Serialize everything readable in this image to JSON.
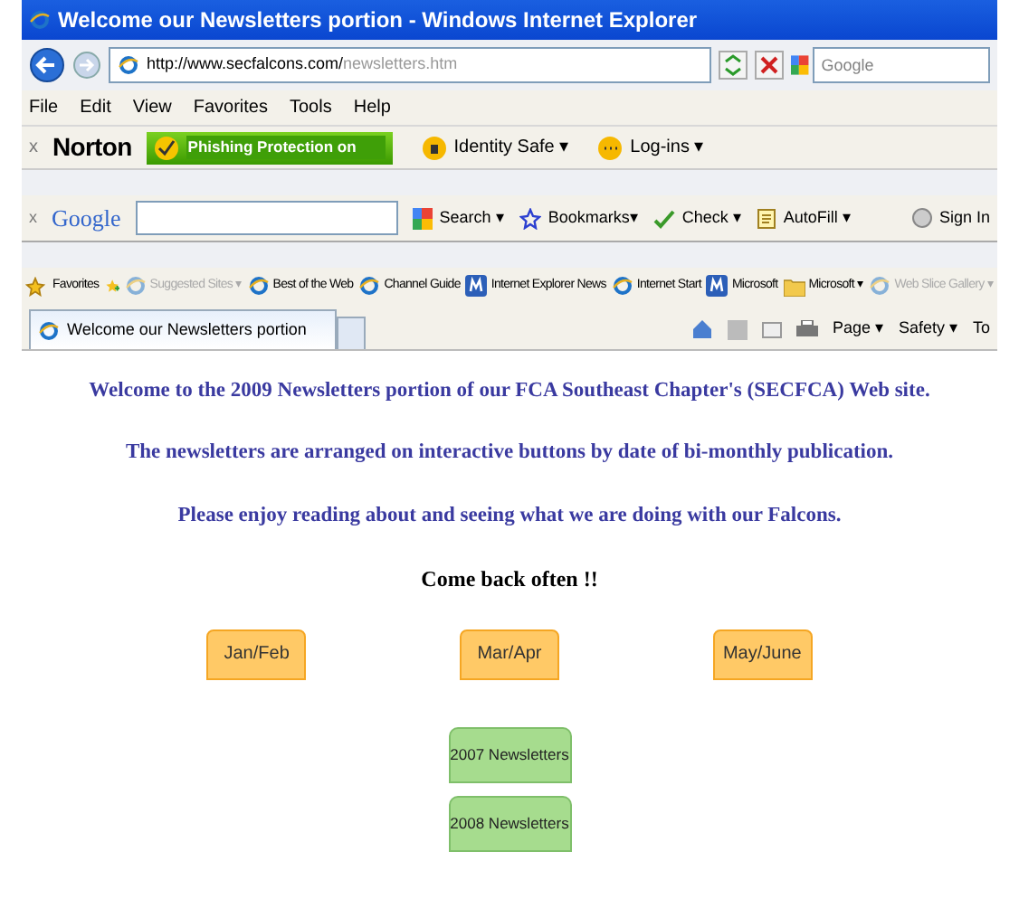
{
  "window": {
    "title": "Welcome our Newsletters portion - Windows Internet Explorer"
  },
  "address_bar": {
    "url_host": "http://www.secfalcons.com/",
    "url_path": "newsletters.htm",
    "search_placeholder": "Google"
  },
  "menu": [
    "File",
    "Edit",
    "View",
    "Favorites",
    "Tools",
    "Help"
  ],
  "norton_toolbar": {
    "close": "x",
    "brand": "Norton",
    "phishing": "Phishing Protection on",
    "items": [
      "Identity Safe ▾",
      "Log-ins ▾"
    ]
  },
  "google_toolbar": {
    "close": "x",
    "brand": "Google",
    "items": [
      {
        "kind": "search",
        "label": "Search ▾"
      },
      {
        "kind": "bookmarks",
        "label": "Bookmarks▾"
      },
      {
        "kind": "check",
        "label": "Check ▾"
      },
      {
        "kind": "autofill",
        "label": "AutoFill ▾"
      },
      {
        "kind": "signin",
        "label": "Sign In"
      }
    ]
  },
  "favorites_bar": {
    "label": "Favorites",
    "items": [
      {
        "label": "Suggested Sites ▾",
        "kind": "ie",
        "disabled": true
      },
      {
        "label": "Best of the Web",
        "kind": "ie",
        "disabled": false
      },
      {
        "label": "Channel Guide",
        "kind": "ie",
        "disabled": false
      },
      {
        "label": "Internet Explorer News",
        "kind": "ms",
        "disabled": false
      },
      {
        "label": "Internet Start",
        "kind": "ie",
        "disabled": false
      },
      {
        "label": "Microsoft",
        "kind": "ms",
        "disabled": false
      },
      {
        "label": "Microsoft ▾",
        "kind": "folder",
        "disabled": false
      },
      {
        "label": "Web Slice Gallery ▾",
        "kind": "ie",
        "disabled": true
      }
    ]
  },
  "tab": {
    "title": "Welcome our Newsletters portion"
  },
  "command_bar": [
    "Page ▾",
    "Safety ▾",
    "To"
  ],
  "page": {
    "paragraphs": [
      {
        "text": "Welcome to the 2009 Newsletters portion of our FCA Southeast Chapter's (SECFCA) Web site.",
        "kind": "intro"
      },
      {
        "text": "The newsletters are arranged on interactive buttons by date of bi-monthly publication.",
        "kind": "intro"
      },
      {
        "text": "Please enjoy reading about and seeing what we are doing with our Falcons.",
        "kind": "intro"
      },
      {
        "text": "Come back often !!",
        "kind": "closing"
      }
    ],
    "month_buttons": [
      "Jan/Feb",
      "Mar/Apr",
      "May/June"
    ],
    "archive_buttons": [
      "2007 Newsletters",
      "2008 Newsletters"
    ]
  }
}
